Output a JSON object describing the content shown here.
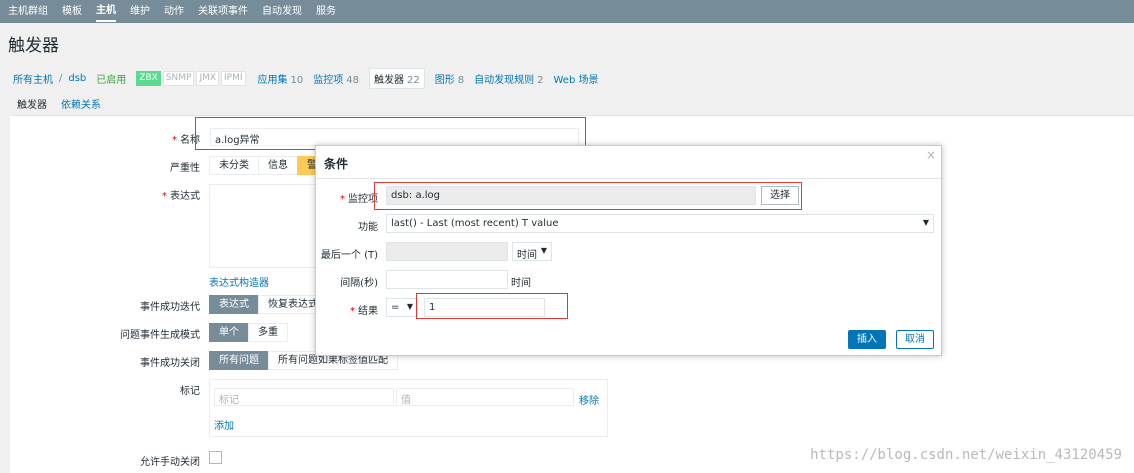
{
  "nav": [
    "主机群组",
    "模板",
    "主机",
    "维护",
    "动作",
    "关联项事件",
    "自动发现",
    "服务"
  ],
  "page_title": "触发器",
  "hostbar": {
    "all_hosts": "所有主机",
    "sep": "/",
    "host": "dsb",
    "status": "已启用",
    "badges": [
      "ZBX",
      "SNMP",
      "JMX",
      "IPMI"
    ],
    "links": [
      {
        "label": "应用集",
        "count": "10"
      },
      {
        "label": "监控项",
        "count": "48"
      },
      {
        "label": "触发器",
        "count": "22"
      },
      {
        "label": "图形",
        "count": "8"
      },
      {
        "label": "自动发现规则",
        "count": "2"
      },
      {
        "label": "Web 场景",
        "count": ""
      }
    ]
  },
  "subtabs": [
    "触发器",
    "依赖关系"
  ],
  "form": {
    "name_label": "名称",
    "name_value": "a.log异常",
    "severity_label": "严重性",
    "severity_options": [
      "未分类",
      "信息",
      "警"
    ],
    "expression_label": "表达式",
    "expr_builder": "表达式构造器",
    "ok_event_label": "事件成功迭代",
    "ok_event_options": [
      "表达式",
      "恢复表达式"
    ],
    "problem_mode_label": "问题事件生成模式",
    "problem_mode_options": [
      "单个",
      "多重"
    ],
    "ok_close_label": "事件成功关闭",
    "ok_close_options": [
      "所有问题",
      "所有问题如果标签值匹配"
    ],
    "tags_label": "标记",
    "tag_placeholder": "标记",
    "value_placeholder": "值",
    "remove": "移除",
    "add": "添加",
    "manual_close_label": "允许手动关闭"
  },
  "modal": {
    "title": "条件",
    "close": "×",
    "item_label": "监控项",
    "item_value": "dsb: a.log",
    "select_btn": "选择",
    "function_label": "功能",
    "function_value": "last() - Last (most recent) T value",
    "last_label": "最后一个 (T)",
    "last_unit": "时间",
    "interval_label": "间隔(秒)",
    "interval_unit": "时间",
    "result_label": "结果",
    "result_op": "=",
    "result_value": "1",
    "insert": "插入",
    "cancel": "取消"
  },
  "watermark": "https://blog.csdn.net/weixin_43120459",
  "colors": {
    "nav": "#768d99",
    "primary": "#0275b8",
    "highlight": "#e33734",
    "enabled": "#429e47"
  }
}
